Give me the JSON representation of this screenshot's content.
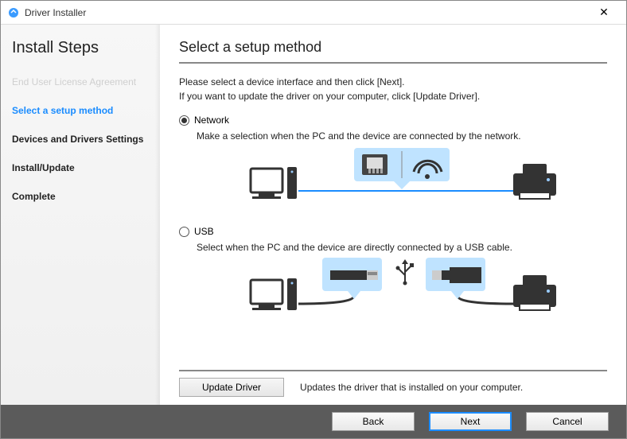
{
  "window": {
    "title": "Driver Installer"
  },
  "sidebar": {
    "heading": "Install Steps",
    "steps": [
      {
        "label": "End User License Agreement",
        "state": "done"
      },
      {
        "label": "Select a setup method",
        "state": "active"
      },
      {
        "label": "Devices and Drivers Settings",
        "state": "pending"
      },
      {
        "label": "Install/Update",
        "state": "pending"
      },
      {
        "label": "Complete",
        "state": "pending"
      }
    ]
  },
  "main": {
    "title": "Select a setup method",
    "intro_line1": "Please select a device interface and then click [Next].",
    "intro_line2": "If you want to update the driver on your computer, click [Update Driver].",
    "options": {
      "network": {
        "label": "Network",
        "selected": true,
        "desc": "Make a selection when the PC and the device are connected by the network."
      },
      "usb": {
        "label": "USB",
        "selected": false,
        "desc": "Select when the PC and the device are directly connected by a USB cable."
      }
    },
    "update": {
      "button": "Update Driver",
      "desc": "Updates the driver that is installed on your computer."
    }
  },
  "footer": {
    "back": "Back",
    "next": "Next",
    "cancel": "Cancel"
  }
}
